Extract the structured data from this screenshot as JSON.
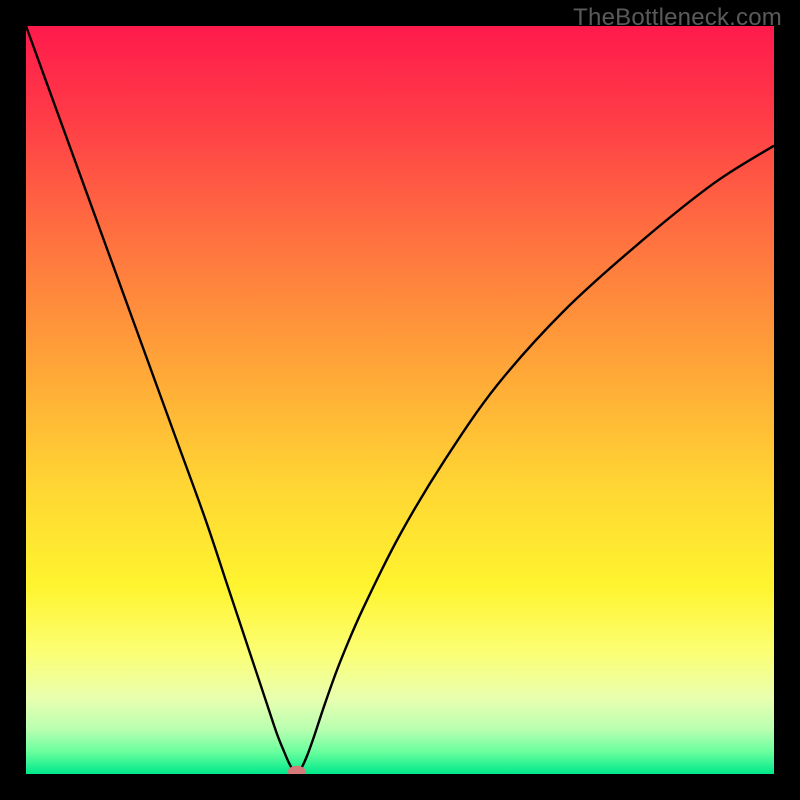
{
  "watermark": "TheBottleneck.com",
  "chart_data": {
    "type": "line",
    "title": "",
    "xlabel": "",
    "ylabel": "",
    "xlim": [
      0,
      100
    ],
    "ylim": [
      0,
      100
    ],
    "background_gradient": {
      "direction": "vertical",
      "stops": [
        {
          "pos": 0.0,
          "color": "#ff1a4c"
        },
        {
          "pos": 0.12,
          "color": "#ff3b47"
        },
        {
          "pos": 0.28,
          "color": "#ff7040"
        },
        {
          "pos": 0.45,
          "color": "#ffa438"
        },
        {
          "pos": 0.62,
          "color": "#ffd733"
        },
        {
          "pos": 0.75,
          "color": "#fff42f"
        },
        {
          "pos": 0.84,
          "color": "#fbff76"
        },
        {
          "pos": 0.9,
          "color": "#e8ffb0"
        },
        {
          "pos": 0.94,
          "color": "#b9ffb0"
        },
        {
          "pos": 0.97,
          "color": "#6bff9e"
        },
        {
          "pos": 1.0,
          "color": "#00e88a"
        }
      ]
    },
    "series": [
      {
        "name": "bottleneck-curve",
        "color": "#000000",
        "x": [
          0,
          4,
          8,
          12,
          16,
          20,
          24,
          27,
          30,
          32,
          33.5,
          34.5,
          35.3,
          36.0,
          36.8,
          37.6,
          38.5,
          40,
          42,
          45,
          50,
          56,
          63,
          72,
          82,
          92,
          100
        ],
        "y": [
          100,
          89,
          78,
          67,
          56,
          45,
          34,
          25,
          16,
          10,
          5.5,
          3.0,
          1.2,
          0.3,
          0.8,
          2.5,
          5.0,
          9.5,
          15,
          22,
          32,
          42,
          52,
          62,
          71,
          79,
          84
        ]
      }
    ],
    "marker": {
      "name": "optimal-point",
      "x": 36.2,
      "y": 0.3,
      "color": "#d47a7a",
      "rx": 9,
      "ry": 6
    }
  }
}
